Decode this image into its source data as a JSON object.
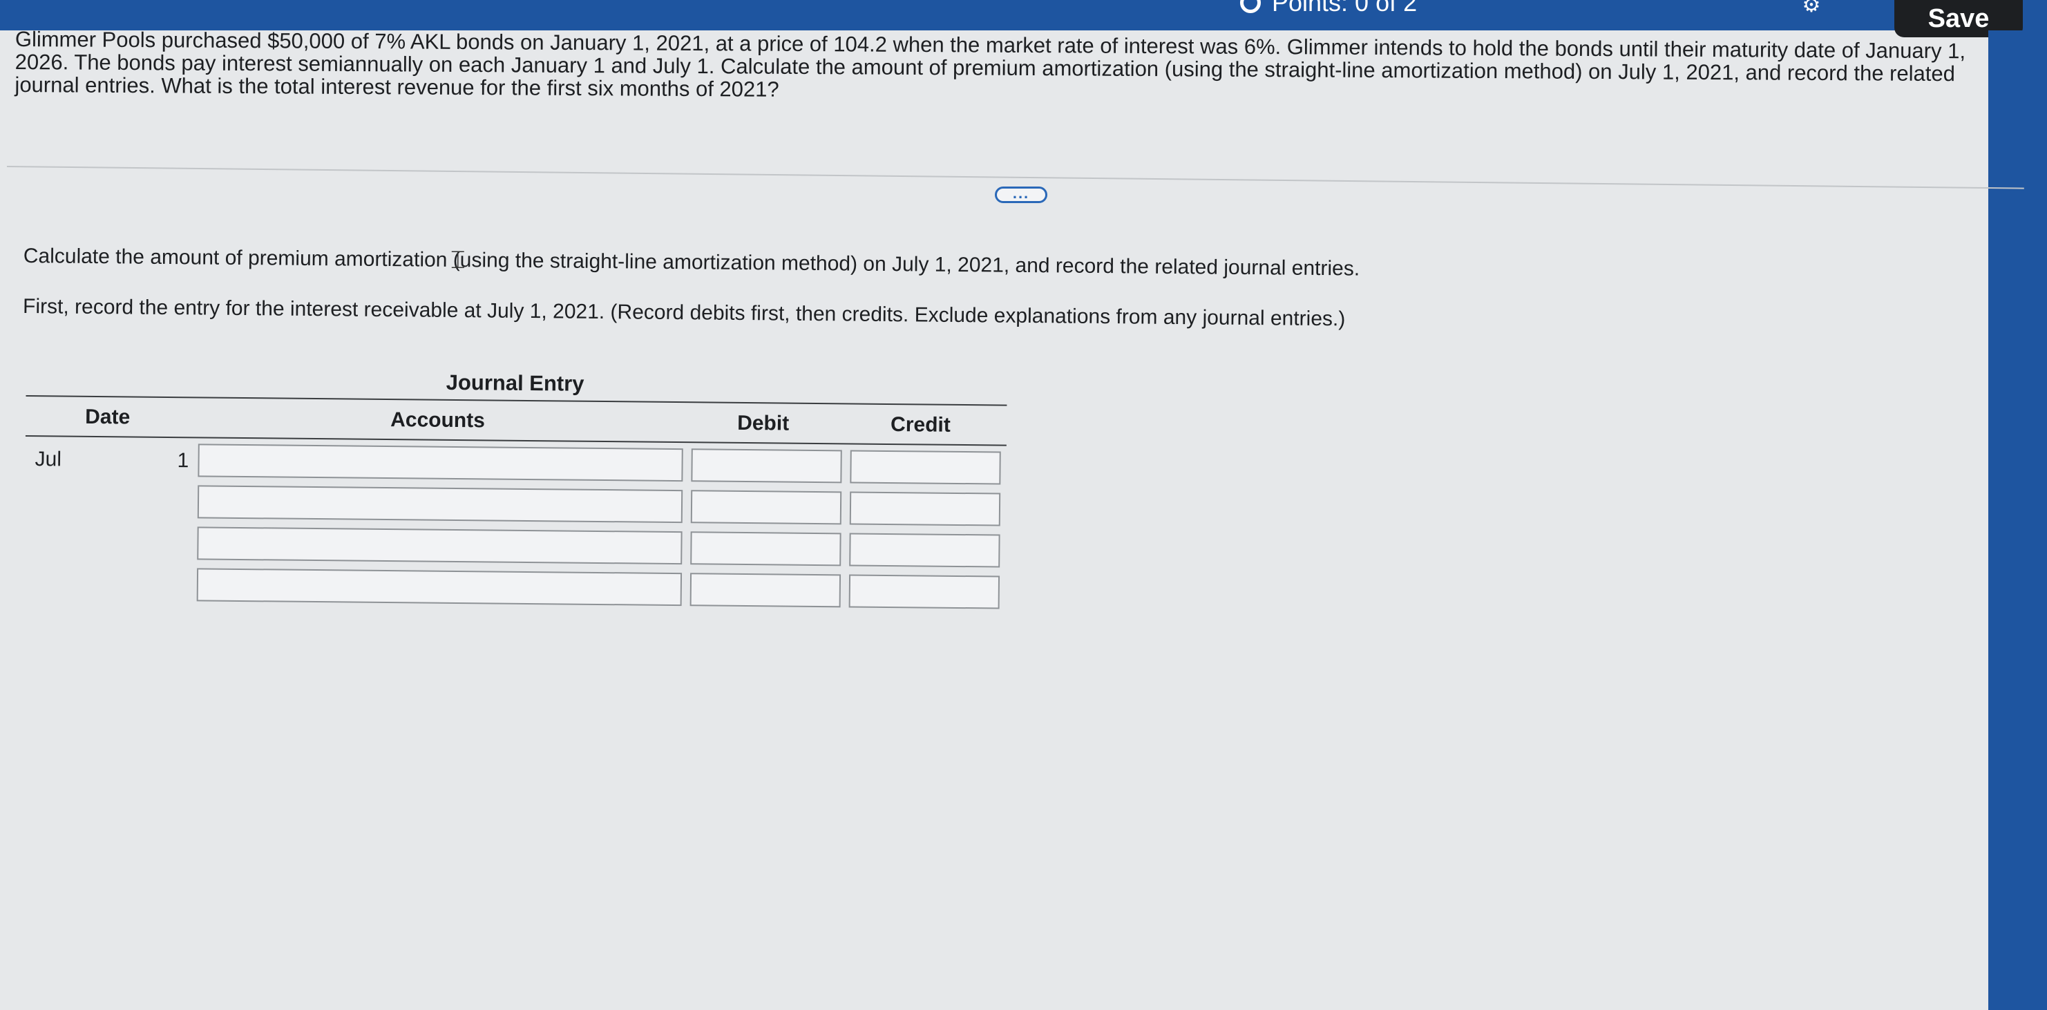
{
  "header": {
    "points_text": "Points: 0 of 2",
    "save_label": "Save"
  },
  "question": {
    "text": "Glimmer Pools purchased $50,000 of 7% AKL bonds on January 1, 2021, at a price of 104.2 when the market rate of interest was 6%. Glimmer intends to hold the bonds until their maturity date of January 1, 2026. The bonds pay interest semiannually on each January 1 and July 1. Calculate the amount of premium amortization (using the straight-line amortization method) on July 1, 2021, and record the related journal entries. What is the total interest revenue for the first six months of 2021?"
  },
  "expand_label": "...",
  "instructions": {
    "line1": "Calculate the amount of premium amortization (using the straight-line amortization method) on July 1, 2021, and record the related journal entries.",
    "line2": "First, record the entry for the interest receivable at July 1, 2021. (Record debits first, then credits. Exclude explanations from any journal entries.)"
  },
  "journal": {
    "title": "Journal Entry",
    "headers": {
      "date": "Date",
      "accounts": "Accounts",
      "debit": "Debit",
      "credit": "Credit"
    },
    "date_month": "Jul",
    "date_day": "1",
    "rows": [
      {
        "account": "",
        "debit": "",
        "credit": ""
      },
      {
        "account": "",
        "debit": "",
        "credit": ""
      },
      {
        "account": "",
        "debit": "",
        "credit": ""
      },
      {
        "account": "",
        "debit": "",
        "credit": ""
      }
    ]
  },
  "colors": {
    "brand_blue": "#1e55a0",
    "save_button": "#1d1f22"
  }
}
